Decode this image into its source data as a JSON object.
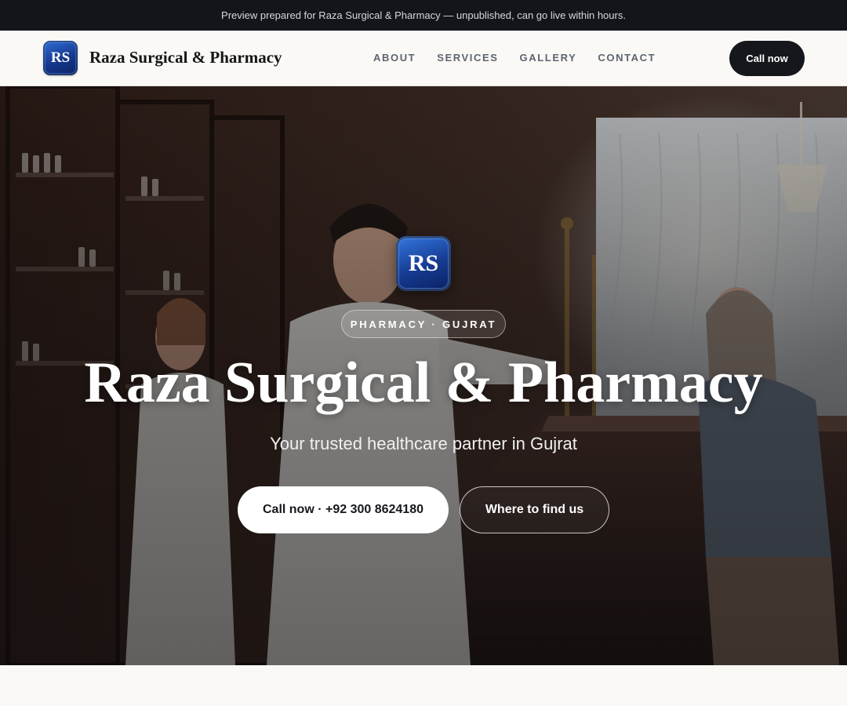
{
  "banner": {
    "text": "Preview prepared for Raza Surgical & Pharmacy — unpublished, can go live within hours."
  },
  "header": {
    "logo_text": "RS",
    "brand_name": "Raza Surgical & Pharmacy",
    "nav": [
      {
        "label": "ABOUT"
      },
      {
        "label": "SERVICES"
      },
      {
        "label": "GALLERY"
      },
      {
        "label": "CONTACT"
      }
    ],
    "cta_label": "Call now"
  },
  "hero": {
    "logo_text": "RS",
    "pill": "PHARMACY · GUJRAT",
    "title": "Raza Surgical & Pharmacy",
    "subtitle": "Your trusted healthcare partner in Gujrat",
    "primary_button": "Call now · +92 300 8624180",
    "secondary_button": "Where to find us",
    "background_description_icon": "pharmacy-photo"
  },
  "colors": {
    "banner_bg": "#12151a",
    "logo_blue": "#1a45a8",
    "dark_button": "#15171c",
    "page_bg": "#faf9f6"
  }
}
